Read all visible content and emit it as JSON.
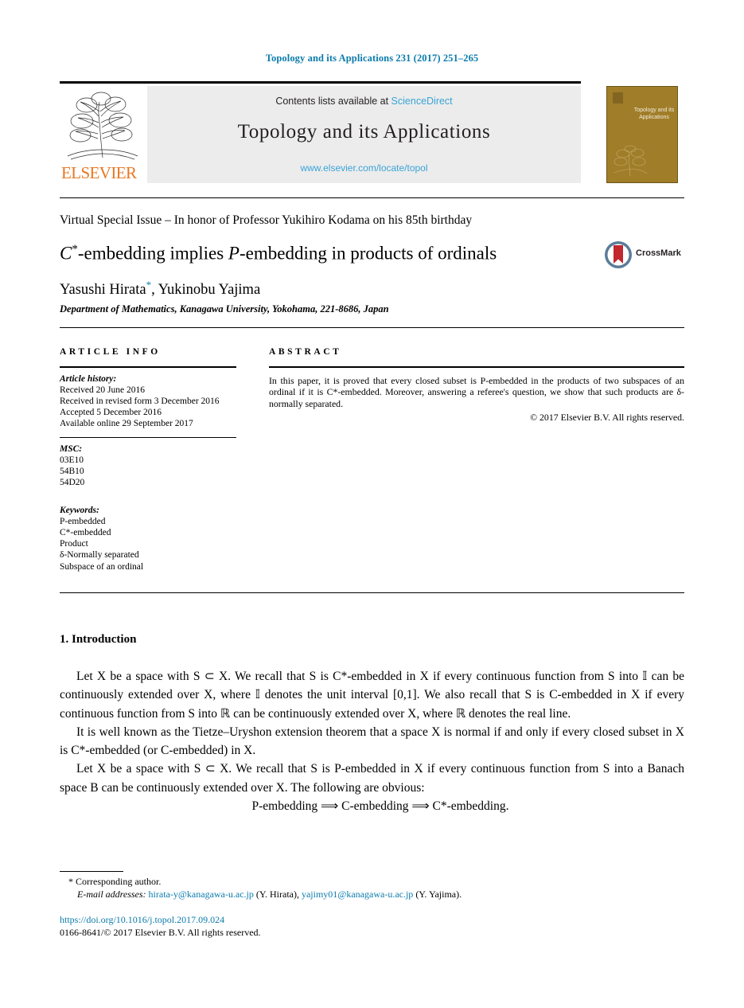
{
  "running_head": "Topology and its Applications 231 (2017) 251–265",
  "masthead": {
    "contents_prefix": "Contents lists available at ",
    "sciencedirect": "ScienceDirect",
    "journal_name": "Topology and its Applications",
    "journal_url": "www.elsevier.com/locate/topol",
    "publisher_wordmark": "ELSEVIER",
    "cover_title": "Topology and its Applications",
    "link_color": "#3aa3d8",
    "banner_bg": "#ececec",
    "cover_bg": "#a07d28",
    "elsevier_orange": "#e87722"
  },
  "title_block": {
    "special_issue": "Virtual Special Issue – In honor of Professor Yukihiro Kodama on his 85th birthday",
    "title_part1": "C",
    "title_star": "*",
    "title_part2": "-embedding implies ",
    "title_p": "P",
    "title_part3": "-embedding in products of ordinals",
    "authors_first": "Yasushi Hirata",
    "authors_star": "*",
    "authors_rest": ", Yukinobu Yajima",
    "affiliation": "Department of Mathematics, Kanagawa University, Yokohama, 221-8686, Japan",
    "crossmark_label": "CrossMark",
    "crossmark_ring_color": "#5b7c99",
    "crossmark_ribbon_color": "#c1272d"
  },
  "article_info": {
    "heading": "ARTICLE INFO",
    "history_label": "Article history:",
    "history": [
      "Received 20 June 2016",
      "Received in revised form 3 December 2016",
      "Accepted 5 December 2016",
      "Available online 29 September 2017"
    ],
    "msc_label": "MSC:",
    "msc": [
      "03E10",
      "54B10",
      "54D20"
    ],
    "keywords_label": "Keywords:",
    "keywords": [
      "P-embedded",
      "C*-embedded",
      "Product",
      "δ-Normally separated",
      "Subspace of an ordinal"
    ]
  },
  "abstract": {
    "heading": "ABSTRACT",
    "text": "In this paper, it is proved that every closed subset is P-embedded in the products of two subspaces of an ordinal if it is C*-embedded. Moreover, answering a referee's question, we show that such products are δ-normally separated.",
    "copyright": "© 2017 Elsevier B.V. All rights reserved."
  },
  "introduction": {
    "heading": "1. Introduction",
    "paragraph1": "Let X be a space with S ⊂ X. We recall that S is C*-embedded in X if every continuous function from S into 𝕀 can be continuously extended over X, where 𝕀 denotes the unit interval [0,1]. We also recall that S is C-embedded in X if every continuous function from S into ℝ can be continuously extended over X, where ℝ denotes the real line.",
    "paragraph2": "It is well known as the Tietze–Uryshon extension theorem that a space X is normal if and only if every closed subset in X is C*-embedded (or C-embedded) in X.",
    "paragraph3": "Let X be a space with S ⊂ X. We recall that S is P-embedded in X if every continuous function from S into a Banach space B can be continuously extended over X. The following are obvious:",
    "display_equation": "P-embedding ⟹ C-embedding ⟹ C*-embedding."
  },
  "footnotes": {
    "corresponding_marker": "*",
    "corresponding_text": "Corresponding author.",
    "email_label": "E-mail addresses:",
    "email1": "hirata-y@kanagawa-u.ac.jp",
    "email1_owner": "(Y. Hirata),",
    "email2": "yajimy01@kanagawa-u.ac.jp",
    "email2_owner": "(Y. Yajima).",
    "doi": "https://doi.org/10.1016/j.topol.2017.09.024",
    "issn_line": "0166-8641/© 2017 Elsevier B.V. All rights reserved."
  }
}
